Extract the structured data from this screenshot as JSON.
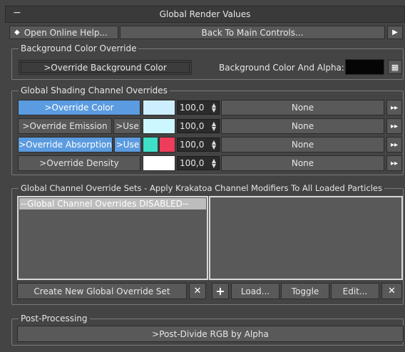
{
  "rollout": {
    "title": "Global Render Values",
    "collapse_symbol": "−"
  },
  "top_bar": {
    "help_icon": "◆",
    "help_label": "Open Online Help...",
    "back_label": "Back To Main Controls...",
    "next_icon": "▶"
  },
  "background_override": {
    "group_label": "Background Color Override",
    "override_button": ">Override Background Color",
    "color_alpha_label": "Background Color And Alpha:",
    "color_value": "#050505",
    "picker_icon": "▦"
  },
  "shading_overrides": {
    "group_label": "Global Shading Channel Overrides",
    "rows": [
      {
        "override": ">Override Color",
        "use": "",
        "swatch1": "#cdeefe",
        "swatch2": "",
        "value": "100,0",
        "map": "None",
        "arrow": "▸▸"
      },
      {
        "override": ">Override Emission",
        "use": ">Use",
        "swatch1": "#cdf7fe",
        "swatch2": "",
        "value": "100,0",
        "map": "None",
        "arrow": "▸▸"
      },
      {
        "override": ">Override Absorption",
        "use": ">Use",
        "swatch1": "#3ee0c8",
        "swatch2": "#ee3d5a",
        "value": "100,0",
        "map": "None",
        "arrow": "▸▸"
      },
      {
        "override": ">Override Density",
        "use": "",
        "swatch1": "#ffffff",
        "swatch2": "",
        "value": "100,0",
        "map": "None",
        "arrow": "▸▸"
      }
    ]
  },
  "override_sets": {
    "group_label": "Global Channel Override Sets - Apply Krakatoa Channel Modifiers To All Loaded Particles",
    "left_list": [
      "--Global Channel Overrides DISABLED--"
    ],
    "create_button": "Create New Global Override Set",
    "delete_icon": "✕",
    "add_icon": "+",
    "load_button": "Load...",
    "toggle_button": "Toggle",
    "edit_button": "Edit...",
    "remove_icon": "✕"
  },
  "post_processing": {
    "group_label": "Post-Processing",
    "divide_button": ">Post-Divide RGB by Alpha"
  }
}
